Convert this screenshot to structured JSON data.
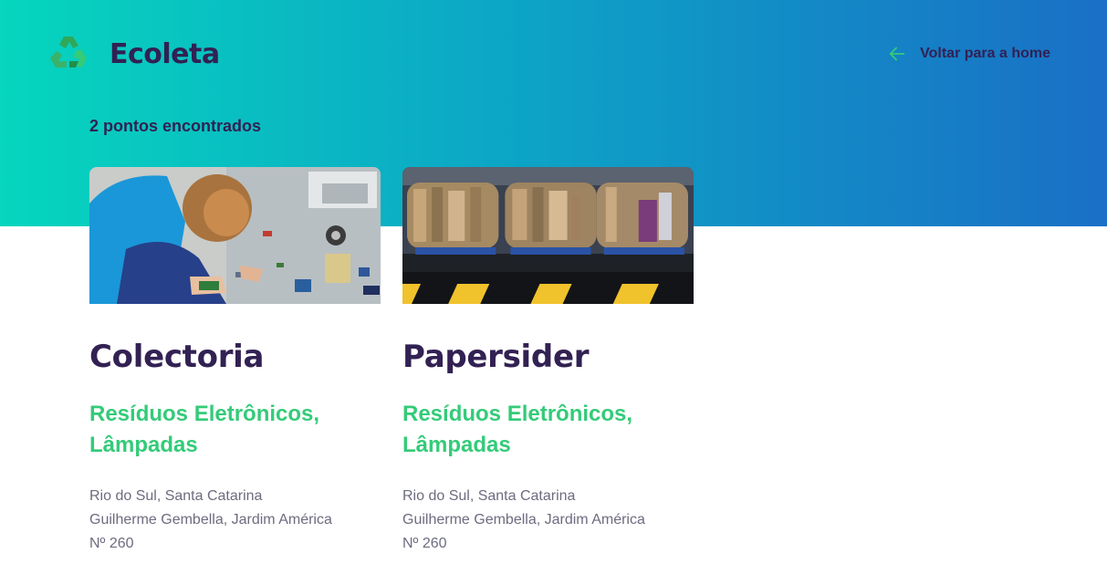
{
  "header": {
    "brand_name": "Ecoleta",
    "logo_icon": "recycle-icon",
    "back_link": {
      "label": "Voltar para a home",
      "icon": "arrow-left-icon"
    }
  },
  "results": {
    "count_text": "2 pontos encontrados"
  },
  "colors": {
    "title": "#322153",
    "accent_green": "#34cb79",
    "text_muted": "#6c6c80",
    "gradient_start": "#06d6bd",
    "gradient_end": "#1a6fc6"
  },
  "points": [
    {
      "name": "Colectoria",
      "items": "Resíduos Eletrônicos, Lâmpadas",
      "address_city": "Rio do Sul, Santa Catarina",
      "address_street": "Guilherme Gembella, Jardim América",
      "address_number": "Nº 260",
      "image": "child-sorting-electronic-waste"
    },
    {
      "name": "Papersider",
      "items": "Resíduos Eletrônicos, Lâmpadas",
      "address_city": "Rio do Sul, Santa Catarina",
      "address_street": "Guilherme Gembella, Jardim América",
      "address_number": "Nº 260",
      "image": "cardboard-bales-on-dock"
    }
  ]
}
